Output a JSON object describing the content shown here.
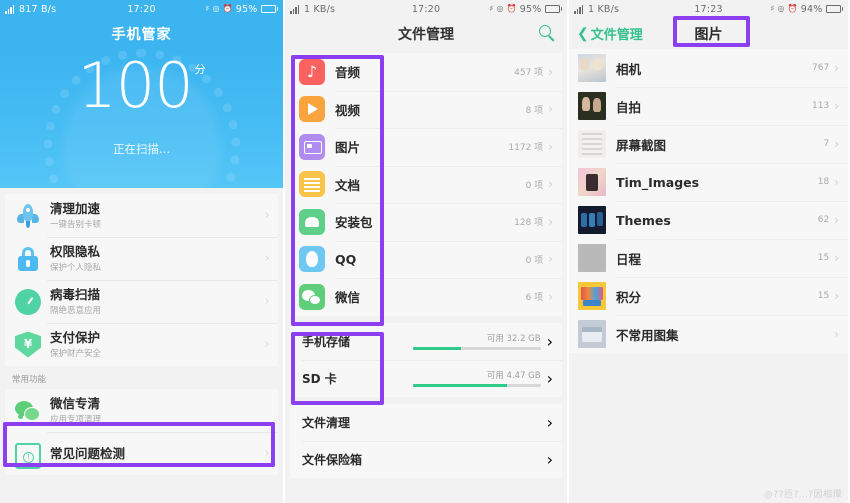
{
  "screens": [
    {
      "id": "phone-manager",
      "statusbar": {
        "network_speed": "817 B/s",
        "time": "17:20",
        "battery_text": "95%",
        "icons": [
          "signal-icon",
          "mute-icon",
          "location-icon",
          "alarm-icon",
          "battery-icon"
        ]
      },
      "header": {
        "title": "手机管家"
      },
      "scan": {
        "score": "100",
        "unit": "分",
        "status": "正在扫描..."
      },
      "main_items": [
        {
          "title": "清理加速",
          "subtitle": "一键告别卡顿",
          "icon": "rocket-icon"
        },
        {
          "title": "权限隐私",
          "subtitle": "保护个人隐私",
          "icon": "lock-icon"
        },
        {
          "title": "病毒扫描",
          "subtitle": "隔绝恶意应用",
          "icon": "virus-scan-icon"
        },
        {
          "title": "支付保护",
          "subtitle": "保护财产安全",
          "icon": "shield-yen-icon"
        }
      ],
      "section_label": "常用功能",
      "common_items": [
        {
          "title": "微信专清",
          "subtitle": "应用专项清理",
          "icon": "wechat-icon",
          "highlighted": true
        },
        {
          "title": "常见问题检测",
          "subtitle": "",
          "icon": "faq-icon",
          "highlighted": false
        }
      ]
    },
    {
      "id": "file-manager",
      "statusbar": {
        "network_speed": "1 KB/s",
        "time": "17:20",
        "battery_text": "95%",
        "icons": [
          "signal-icon",
          "mute-icon",
          "location-icon",
          "alarm-icon",
          "battery-icon"
        ]
      },
      "header": {
        "title": "文件管理",
        "search_icon": "search-icon"
      },
      "categories": [
        {
          "name": "音频",
          "count": "457 项",
          "icon": "audio-icon"
        },
        {
          "name": "视频",
          "count": "8 项",
          "icon": "video-icon"
        },
        {
          "name": "图片",
          "count": "1172 项",
          "icon": "picture-icon"
        },
        {
          "name": "文档",
          "count": "0 项",
          "icon": "document-icon"
        },
        {
          "name": "安装包",
          "count": "128 项",
          "icon": "apk-icon"
        },
        {
          "name": "QQ",
          "count": "0 项",
          "icon": "qq-icon"
        },
        {
          "name": "微信",
          "count": "6 项",
          "icon": "wechat-icon"
        }
      ],
      "storage": [
        {
          "name": "手机存储",
          "available": "可用 32.2 GB",
          "used_percent": 38
        },
        {
          "name": "SD 卡",
          "available": "可用 4.47 GB",
          "used_percent": 74
        }
      ],
      "tools": [
        {
          "name": "文件清理"
        },
        {
          "name": "文件保险箱"
        }
      ]
    },
    {
      "id": "pictures",
      "statusbar": {
        "network_speed": "1 KB/s",
        "time": "17:23",
        "battery_text": "94%",
        "icons": [
          "signal-icon",
          "mute-icon",
          "location-icon",
          "alarm-icon",
          "battery-icon"
        ]
      },
      "header": {
        "back_label": "文件管理",
        "title": "图片",
        "back_icon": "chevron-left-icon"
      },
      "albums": [
        {
          "name": "相机",
          "count": "767",
          "thumb": "camera-thumb"
        },
        {
          "name": "自拍",
          "count": "113",
          "thumb": "selfie-thumb"
        },
        {
          "name": "屏幕截图",
          "count": "7",
          "thumb": "screenshot-thumb"
        },
        {
          "name": "Tim_Images",
          "count": "18",
          "thumb": "tim-thumb"
        },
        {
          "name": "Themes",
          "count": "62",
          "thumb": "themes-thumb"
        },
        {
          "name": "日程",
          "count": "15",
          "thumb": "schedule-thumb"
        },
        {
          "name": "积分",
          "count": "15",
          "thumb": "points-thumb"
        },
        {
          "name": "不常用图集",
          "count": "",
          "thumb": "rarely-used-thumb"
        }
      ],
      "watermark": "@??匝?…?因相燂"
    }
  ],
  "colors": {
    "brand_blue": "#3cb4f0",
    "accent_green": "#35c18e",
    "highlight_purple": "#8b3ff0",
    "background_gray": "#f2f2f2",
    "card_gray": "#f7f7f7"
  }
}
